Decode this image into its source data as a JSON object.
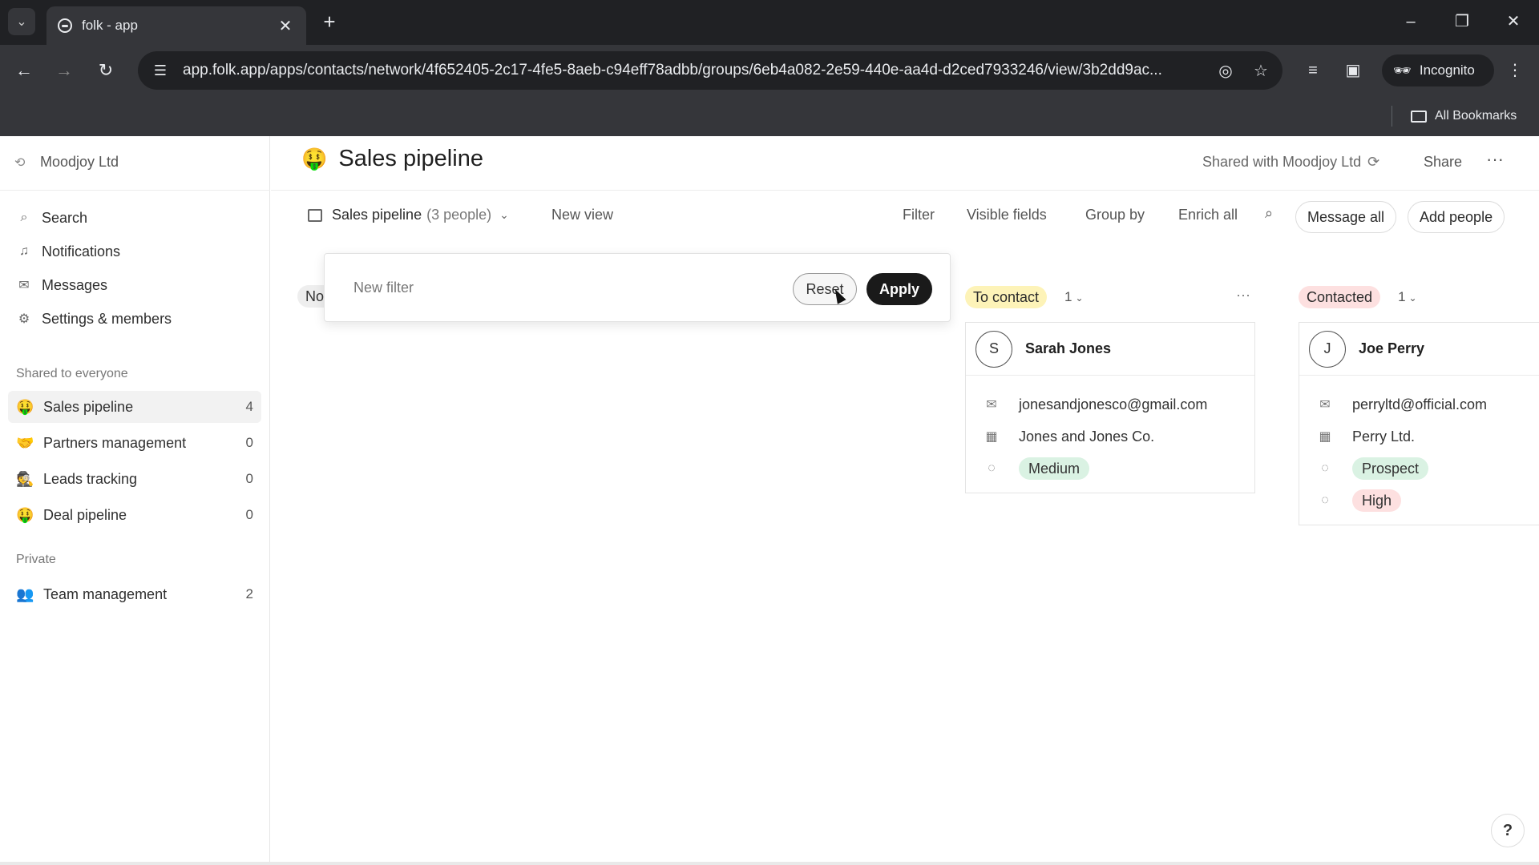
{
  "browser": {
    "tab_title": "folk - app",
    "url": "app.folk.app/apps/contacts/network/4f652405-2c17-4fe5-8aeb-c94eff78adbb/groups/6eb4a082-2e59-440e-aa4d-d2ced7933246/view/3b2dd9ac...",
    "incognito_label": "Incognito",
    "bookmarks_label": "All Bookmarks"
  },
  "sidebar": {
    "workspace": "Moodjoy Ltd",
    "nav": [
      {
        "label": "Search",
        "icon": "search-icon"
      },
      {
        "label": "Notifications",
        "icon": "bell-icon"
      },
      {
        "label": "Messages",
        "icon": "mail-icon"
      },
      {
        "label": "Settings & members",
        "icon": "gear-icon"
      }
    ],
    "shared_heading": "Shared to everyone",
    "shared_groups": [
      {
        "label": "Sales pipeline",
        "emoji": "🤑",
        "count": "4"
      },
      {
        "label": "Partners management",
        "emoji": "🤝",
        "count": "0"
      },
      {
        "label": "Leads tracking",
        "emoji": "🕵️",
        "count": "0"
      },
      {
        "label": "Deal pipeline",
        "emoji": "🤑",
        "count": "0"
      }
    ],
    "private_heading": "Private",
    "private_groups": [
      {
        "label": "Team management",
        "emoji": "👥",
        "count": "2"
      }
    ]
  },
  "header": {
    "emoji": "🤑",
    "title": "Sales pipeline",
    "shared_with": "Shared with Moodjoy Ltd",
    "share_label": "Share",
    "more_label": "···"
  },
  "viewbar": {
    "view_name": "Sales pipeline",
    "people_count": "(3 people)",
    "new_view": "New view",
    "filter": "Filter",
    "visible_fields": "Visible fields",
    "group_by": "Group by",
    "enrich_all": "Enrich all",
    "message_all": "Message all",
    "add_people": "Add people"
  },
  "filter_popover": {
    "new_filter": "New filter",
    "reset": "Reset",
    "apply": "Apply"
  },
  "columns": [
    {
      "status": "No",
      "status_color": "#eeeeee"
    },
    {
      "status": "To contact",
      "status_color": "#fdf3b8",
      "count": "1",
      "more_label": "···",
      "card": {
        "initial": "S",
        "name": "Sarah Jones",
        "email": "jonesandjonesco@gmail.com",
        "company": "Jones and Jones Co.",
        "tags": [
          {
            "label": "Medium",
            "color": "#daf2e3"
          }
        ]
      }
    },
    {
      "status": "Contacted",
      "status_color": "#fde0e0",
      "count": "1",
      "card": {
        "initial": "J",
        "name": "Joe Perry",
        "email": "perryltd@official.com",
        "company": "Perry Ltd.",
        "tags": [
          {
            "label": "Prospect",
            "color": "#daf2e3"
          },
          {
            "label": "High",
            "color": "#fde0e0"
          }
        ]
      }
    }
  ],
  "help_label": "?"
}
